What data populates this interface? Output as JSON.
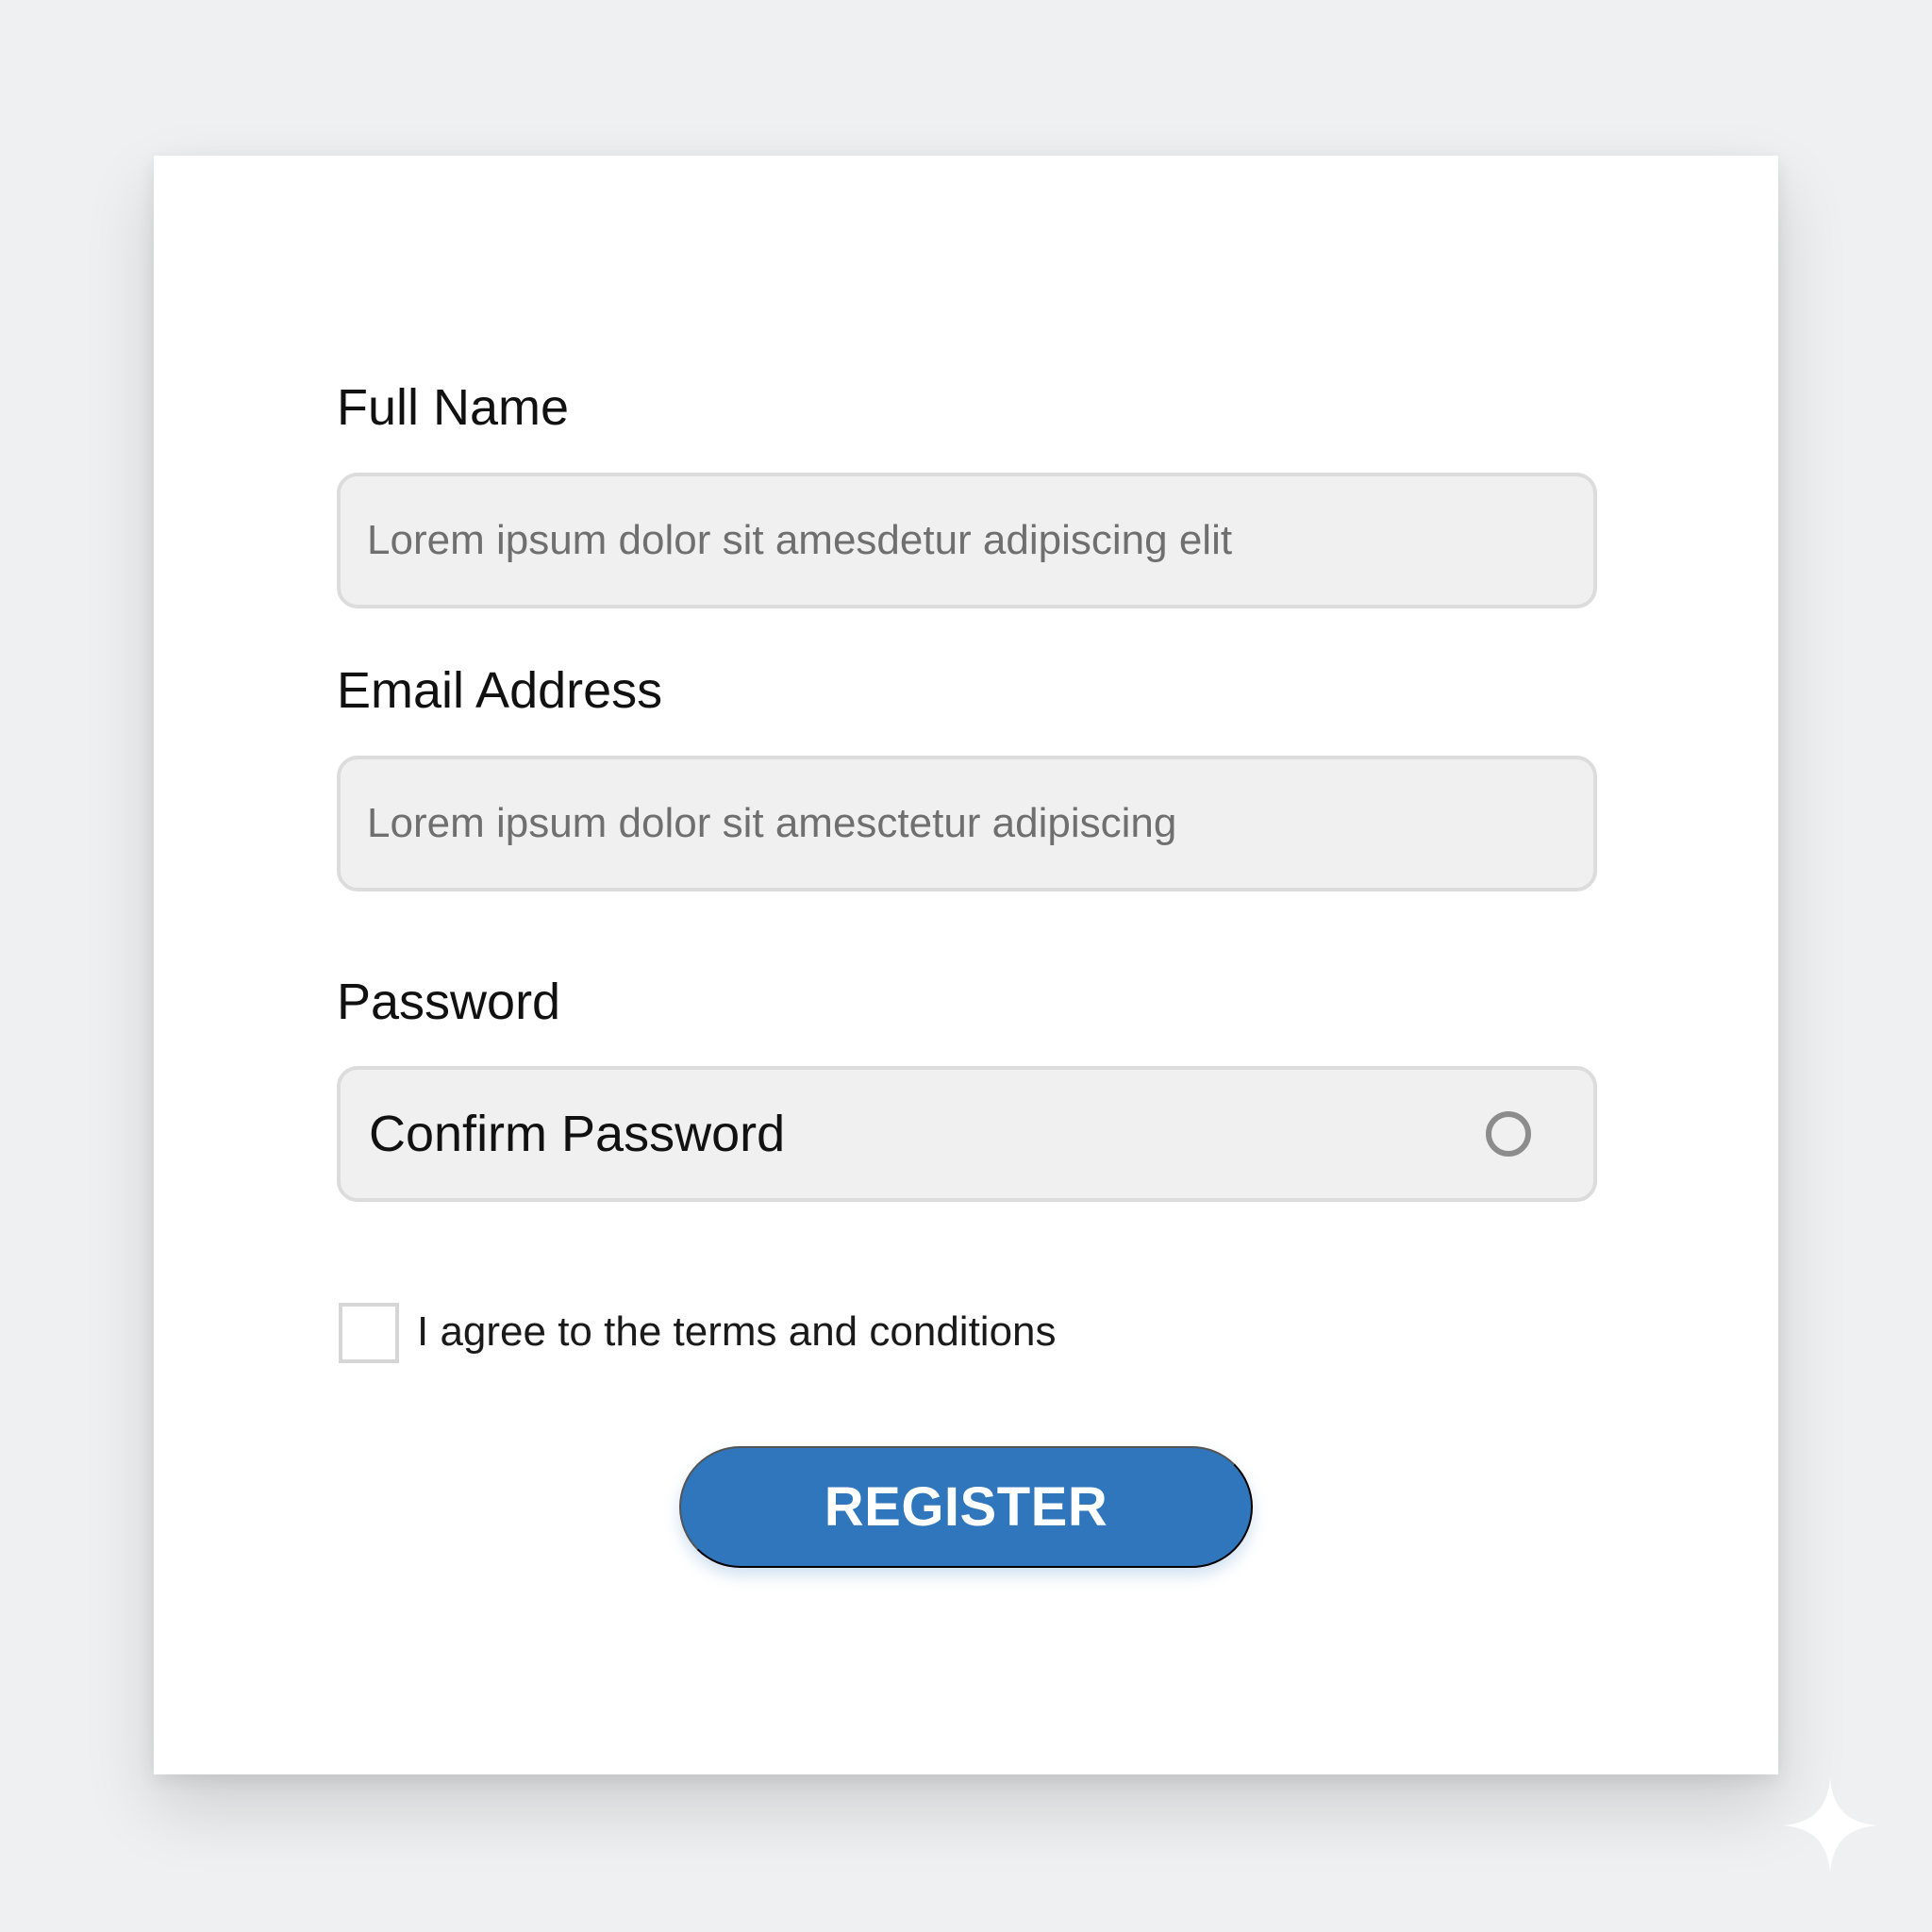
{
  "form": {
    "full_name": {
      "label": "Full Name",
      "value": "Lorem ipsum dolor sit amesdetur adipiscing elit"
    },
    "email": {
      "label": "Email Address",
      "value": "Lorem ipsum dolor sit amesctetur adipiscing"
    },
    "password": {
      "label": "Password",
      "value": "Confirm Password"
    },
    "terms": {
      "text": "I agree to the terms and conditions",
      "checked": false
    },
    "submit_label": "REGISTER"
  },
  "icons": {
    "password_toggle": "circle-outline-icon",
    "watermark": "sparkle-icon"
  },
  "colors": {
    "background": "#eff0f1",
    "card": "#ffffff",
    "field": "#f0f0f0",
    "button": "#2f76bd",
    "button_text": "#ffffff"
  }
}
